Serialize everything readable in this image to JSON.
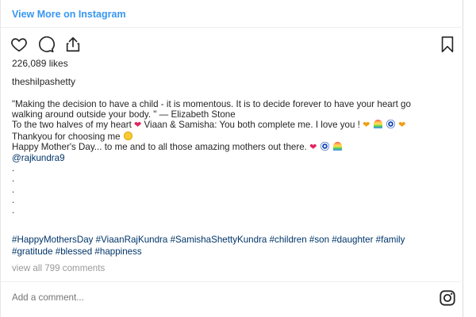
{
  "header": {
    "view_more": "View More on Instagram"
  },
  "icons": {
    "like": "heart-outline-icon",
    "comment": "speech-bubble-icon",
    "share": "share-icon",
    "save": "bookmark-icon",
    "brand": "instagram-icon"
  },
  "post": {
    "likes": "226,089 likes",
    "username": "theshilpashetty",
    "caption": {
      "line1": "\"Making the decision to have a child - it is momentous. It is to decide forever to have your heart go",
      "line2": "walking around outside your body. \" — Elizabeth Stone",
      "line3a": "To the two halves of my heart",
      "line3b": " Viaan & Samisha: You both complete me. I love you !",
      "line4": "Thankyou for choosing me",
      "line5": "Happy Mother's Day... to me and to all those amazing mothers out there.",
      "mention": "@rajkundra9",
      "dots": [
        ".",
        ".",
        ".",
        ".",
        "."
      ]
    },
    "hashtags_line1": "#HappyMothersDay #ViaanRajKundra #SamishaShettyKundra #children #son #daughter #family",
    "hashtags_line2": "#gratitude #blessed #happiness",
    "view_all_comments": "view all 799 comments"
  },
  "comment_box": {
    "placeholder": "Add a comment..."
  },
  "colors": {
    "link_blue": "#3897f0",
    "hashtag": "#003569",
    "muted": "#999999",
    "text": "#262626"
  }
}
